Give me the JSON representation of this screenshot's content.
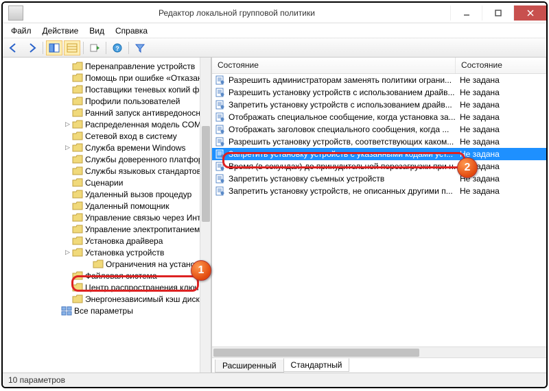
{
  "title": "Редактор локальной групповой политики",
  "menu": {
    "file": "Файл",
    "action": "Действие",
    "view": "Вид",
    "help": "Справка"
  },
  "tree": {
    "items": [
      "Перенаправление устройств",
      "Помощь при ошибке «Отказан",
      "Поставщики теневых копий фай",
      "Профили пользователей",
      "Ранний запуск антивредоносн",
      "Распределенная модель COM",
      "Сетевой вход в систему",
      "Служба времени Windows",
      "Службы доверенного платфор",
      "Службы языковых стандартов",
      "Сценарии",
      "Удаленный вызов процедур",
      "Удаленный помощник",
      "Управление связью через Инт",
      "Управление электропитанием",
      "Установка драйвера",
      "Установка устройств",
      "Ограничения на установку",
      "Файловая система",
      "Центр распространения ключ",
      "Энергонезависимый кэш диск"
    ],
    "all_params": "Все параметры"
  },
  "list": {
    "header": {
      "c1": "Состояние",
      "c2": "Состояние"
    },
    "rows": [
      {
        "name": "Разрешить администраторам заменять политики ограни...",
        "state": "Не задана"
      },
      {
        "name": "Разрешить установку устройств с использованием драйв...",
        "state": "Не задана"
      },
      {
        "name": "Запретить установку устройств с использованием драйв...",
        "state": "Не задана"
      },
      {
        "name": "Отображать специальное сообщение, когда установка за...",
        "state": "Не задана"
      },
      {
        "name": "Отображать заголовок специального сообщения, когда ...",
        "state": "Не задана"
      },
      {
        "name": "Разрешить установку устройств, соответствующих каком...",
        "state": "Не задана"
      },
      {
        "name": "Запретить установку устройств с указанными кодами уст...",
        "state": "Не задана"
      },
      {
        "name": "Время (в секундах) до принудительной перезагрузки при н...",
        "state": "Не задана"
      },
      {
        "name": "Запретить установку съемных устройств",
        "state": "Не задана"
      },
      {
        "name": "Запретить установку устройств, не описанных другими п...",
        "state": "Не задана"
      }
    ]
  },
  "tabs": {
    "extended": "Расширенный",
    "standard": "Стандартный"
  },
  "status": "10 параметров",
  "annotations": {
    "b1": "1",
    "b2": "2"
  }
}
